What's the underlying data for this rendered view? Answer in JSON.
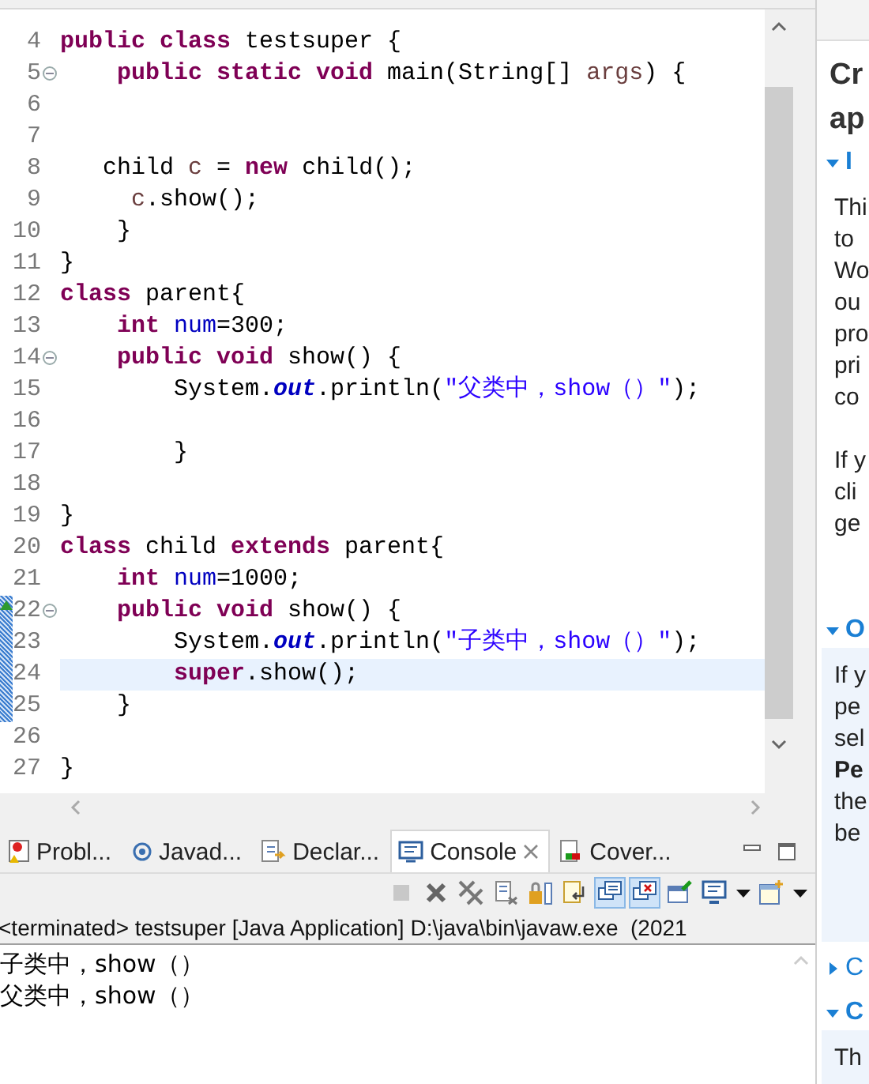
{
  "editor": {
    "lines": [
      {
        "number": "4",
        "fold": false,
        "current": false,
        "changed": false,
        "override": false,
        "tokens": [
          {
            "kind": "keyword",
            "text": "public class"
          },
          {
            "kind": "plain",
            "text": " testsuper {"
          }
        ]
      },
      {
        "number": "5",
        "fold": true,
        "current": false,
        "changed": false,
        "override": false,
        "tokens": [
          {
            "kind": "keyword",
            "text": "    public static void"
          },
          {
            "kind": "plain",
            "text": " main(String[] "
          },
          {
            "kind": "local",
            "text": "args"
          },
          {
            "kind": "plain",
            "text": ") {"
          }
        ]
      },
      {
        "number": "6",
        "fold": false,
        "current": false,
        "changed": false,
        "override": false
      },
      {
        "number": "7",
        "fold": false,
        "current": false,
        "changed": false,
        "override": false
      },
      {
        "number": "8",
        "fold": false,
        "current": false,
        "changed": false,
        "override": false,
        "tokens": [
          {
            "kind": "plain",
            "text": "   child "
          },
          {
            "kind": "local",
            "text": "c"
          },
          {
            "kind": "plain",
            "text": " = "
          },
          {
            "kind": "keyword",
            "text": "new"
          },
          {
            "kind": "plain",
            "text": " child();"
          }
        ]
      },
      {
        "number": "9",
        "fold": false,
        "current": false,
        "changed": false,
        "override": false,
        "tokens": [
          {
            "kind": "local",
            "text": "     c"
          },
          {
            "kind": "plain",
            "text": ".show();"
          }
        ]
      },
      {
        "number": "10",
        "fold": false,
        "current": false,
        "changed": false,
        "override": false,
        "tokens": [
          {
            "kind": "plain",
            "text": "    }"
          }
        ]
      },
      {
        "number": "11",
        "fold": false,
        "current": false,
        "changed": false,
        "override": false,
        "tokens": [
          {
            "kind": "plain",
            "text": "}"
          }
        ]
      },
      {
        "number": "12",
        "fold": false,
        "current": false,
        "changed": false,
        "override": false,
        "tokens": [
          {
            "kind": "keyword",
            "text": "class"
          },
          {
            "kind": "plain",
            "text": " parent{"
          }
        ]
      },
      {
        "number": "13",
        "fold": false,
        "current": false,
        "changed": false,
        "override": false,
        "tokens": [
          {
            "kind": "keyword",
            "text": "    int"
          },
          {
            "kind": "field",
            "text": " num"
          },
          {
            "kind": "plain",
            "text": "=300;"
          }
        ]
      },
      {
        "number": "14",
        "fold": true,
        "current": false,
        "changed": false,
        "override": false,
        "tokens": [
          {
            "kind": "keyword",
            "text": "    public void"
          },
          {
            "kind": "plain",
            "text": " show() {"
          }
        ]
      },
      {
        "number": "15",
        "fold": false,
        "current": false,
        "changed": false,
        "override": false,
        "tokens": [
          {
            "kind": "plain",
            "text": "        System."
          },
          {
            "kind": "static-field",
            "text": "out"
          },
          {
            "kind": "plain",
            "text": ".println("
          },
          {
            "kind": "string",
            "text": "\"父类中，show（）\""
          },
          {
            "kind": "plain",
            "text": ");"
          }
        ]
      },
      {
        "number": "16",
        "fold": false,
        "current": false,
        "changed": false,
        "override": false
      },
      {
        "number": "17",
        "fold": false,
        "current": false,
        "changed": false,
        "override": false,
        "tokens": [
          {
            "kind": "plain",
            "text": "        }"
          }
        ]
      },
      {
        "number": "18",
        "fold": false,
        "current": false,
        "changed": false,
        "override": false
      },
      {
        "number": "19",
        "fold": false,
        "current": false,
        "changed": false,
        "override": false,
        "tokens": [
          {
            "kind": "plain",
            "text": "}"
          }
        ]
      },
      {
        "number": "20",
        "fold": false,
        "current": false,
        "changed": false,
        "override": false,
        "tokens": [
          {
            "kind": "keyword",
            "text": "class"
          },
          {
            "kind": "plain",
            "text": " child "
          },
          {
            "kind": "keyword",
            "text": "extends"
          },
          {
            "kind": "plain",
            "text": " parent{"
          }
        ]
      },
      {
        "number": "21",
        "fold": false,
        "current": false,
        "changed": false,
        "override": false,
        "tokens": [
          {
            "kind": "keyword",
            "text": "    int"
          },
          {
            "kind": "field",
            "text": " num"
          },
          {
            "kind": "plain",
            "text": "=1000;"
          }
        ]
      },
      {
        "number": "22",
        "fold": true,
        "current": false,
        "changed": true,
        "override": true,
        "tokens": [
          {
            "kind": "keyword",
            "text": "    public void"
          },
          {
            "kind": "plain",
            "text": " show() {"
          }
        ]
      },
      {
        "number": "23",
        "fold": false,
        "current": false,
        "changed": true,
        "override": false,
        "tokens": [
          {
            "kind": "plain",
            "text": "        System."
          },
          {
            "kind": "static-field",
            "text": "out"
          },
          {
            "kind": "plain",
            "text": ".println("
          },
          {
            "kind": "string",
            "text": "\"子类中，show（）\""
          },
          {
            "kind": "plain",
            "text": ");"
          }
        ]
      },
      {
        "number": "24",
        "fold": false,
        "current": true,
        "changed": true,
        "override": false,
        "tokens": [
          {
            "kind": "keyword",
            "text": "        super"
          },
          {
            "kind": "plain",
            "text": ".show();"
          }
        ]
      },
      {
        "number": "25",
        "fold": false,
        "current": false,
        "changed": true,
        "override": false,
        "tokens": [
          {
            "kind": "plain",
            "text": "    }"
          }
        ]
      },
      {
        "number": "26",
        "fold": false,
        "current": false,
        "changed": false,
        "override": false
      },
      {
        "number": "27",
        "fold": false,
        "current": false,
        "changed": false,
        "override": false,
        "tokens": [
          {
            "kind": "plain",
            "text": "}"
          }
        ]
      }
    ]
  },
  "console": {
    "tabs": [
      {
        "kind": "problems",
        "label": "Probl...",
        "selected": false
      },
      {
        "kind": "javadoc",
        "label": "Javad...",
        "selected": false
      },
      {
        "kind": "declaration",
        "label": "Declar...",
        "selected": false
      },
      {
        "kind": "console",
        "label": "Console",
        "selected": true
      },
      {
        "kind": "coverage",
        "label": "Cover...",
        "selected": false
      }
    ],
    "toolbar": [
      {
        "kind": "terminate",
        "selected": false,
        "disabled": true
      },
      {
        "kind": "remove",
        "selected": false,
        "disabled": false
      },
      {
        "kind": "remove-all",
        "selected": false,
        "disabled": false
      },
      {
        "kind": "clear",
        "selected": false,
        "disabled": false
      },
      {
        "kind": "lock",
        "selected": false,
        "disabled": false
      },
      {
        "kind": "wrap",
        "selected": false,
        "disabled": false
      },
      {
        "kind": "stdout",
        "selected": true,
        "disabled": false
      },
      {
        "kind": "stderr",
        "selected": true,
        "disabled": false
      },
      {
        "kind": "pin",
        "selected": false,
        "disabled": false
      },
      {
        "kind": "display",
        "selected": false,
        "disabled": false
      },
      {
        "kind": "dropdown",
        "selected": false,
        "disabled": false
      },
      {
        "kind": "open",
        "selected": false,
        "disabled": false
      },
      {
        "kind": "dropdown",
        "selected": false,
        "disabled": false
      }
    ],
    "header": "<terminated> testsuper [Java Application] D:\\java\\bin\\javaw.exe  (2021",
    "output": [
      "子类中，show（）",
      "父类中，show（）"
    ]
  },
  "help": {
    "title": [
      "Cr",
      "ap"
    ],
    "sections": [
      {
        "heading": "I",
        "expanded": true,
        "highlighted": false,
        "paragraphs": [
          [
            {
              "text": "Thi",
              "bold": false
            },
            {
              "text": "to",
              "bold": false
            },
            {
              "text": "Wo",
              "bold": false
            },
            {
              "text": "ou",
              "bold": false
            },
            {
              "text": "pro",
              "bold": false
            },
            {
              "text": "pri",
              "bold": false
            },
            {
              "text": "co",
              "bold": false
            }
          ],
          [
            {
              "text": "If y",
              "bold": false
            },
            {
              "text": "cli",
              "bold": false
            },
            {
              "text": "ge",
              "bold": false
            }
          ]
        ]
      },
      {
        "heading": "O",
        "expanded": true,
        "highlighted": true,
        "paragraphs": [
          [
            {
              "text": "If y",
              "bold": false
            },
            {
              "text": "pe",
              "bold": false
            },
            {
              "text": "sel",
              "bold": false
            },
            {
              "text": "Pe",
              "bold": true
            },
            {
              "text": "the",
              "bold": false
            },
            {
              "text": "be",
              "bold": false
            }
          ]
        ]
      },
      {
        "heading": "C",
        "expanded": false
      },
      {
        "heading": "C",
        "expanded": true,
        "highlighted": true,
        "paragraphs": [
          [
            {
              "text": "Th",
              "bold": false
            }
          ]
        ]
      }
    ]
  }
}
